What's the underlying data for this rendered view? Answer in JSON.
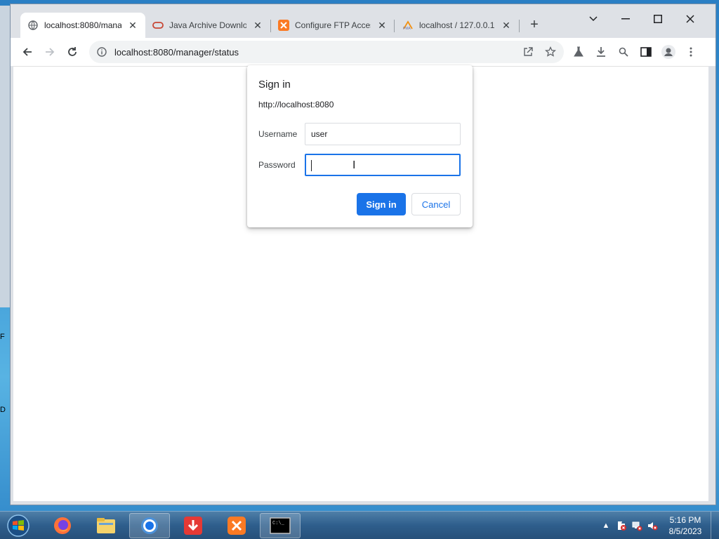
{
  "desktop": {
    "edge_text_1": "F",
    "edge_text_2": "D"
  },
  "browser": {
    "tabs": [
      {
        "title": "localhost:8080/mana",
        "icon": "globe-icon",
        "active": true
      },
      {
        "title": "Java Archive Downlo",
        "icon": "oracle-icon",
        "active": false
      },
      {
        "title": "Configure FTP Access",
        "icon": "xampp-icon",
        "active": false
      },
      {
        "title": "localhost / 127.0.0.1",
        "icon": "phpmyadmin-icon",
        "active": false
      }
    ],
    "new_tab_label": "+",
    "address": "localhost:8080/manager/status"
  },
  "dialog": {
    "title": "Sign in",
    "origin": "http://localhost:8080",
    "username_label": "Username",
    "username_value": "user",
    "password_label": "Password",
    "password_value": "",
    "signin_button": "Sign in",
    "cancel_button": "Cancel"
  },
  "taskbar": {
    "clock_time": "5:16 PM",
    "clock_date": "8/5/2023",
    "apps": [
      "firefox-icon",
      "file-explorer-icon",
      "chrome-icon",
      "download-manager-icon",
      "xampp-icon",
      "command-prompt-icon"
    ]
  },
  "colors": {
    "accent": "#1a73e8",
    "tabstrip": "#dee1e6",
    "taskbar": "#2e5e8c"
  }
}
